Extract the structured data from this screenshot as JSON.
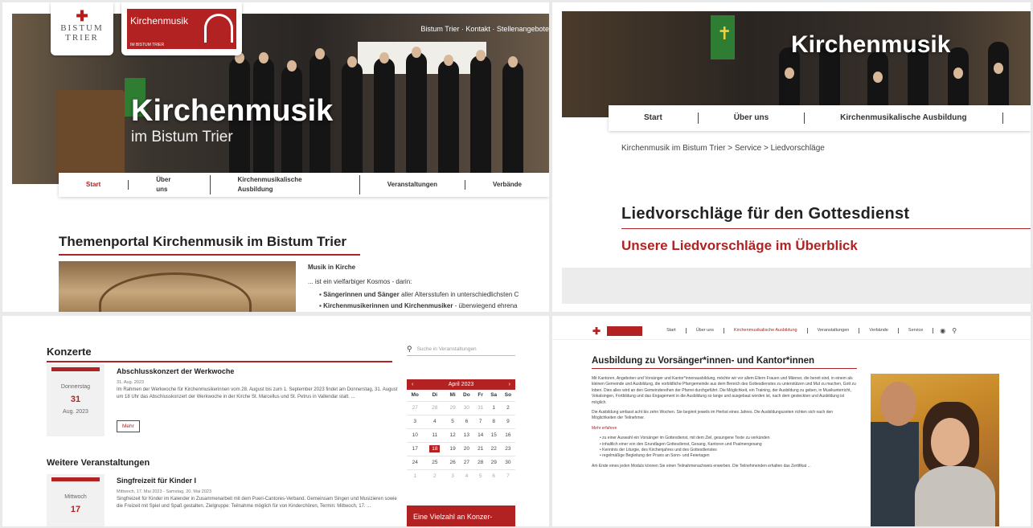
{
  "panel1": {
    "logo_bistum": "BISTUM TRIER",
    "logo_bistum_l1": "BISTUM",
    "logo_bistum_l2": "TRIER",
    "logo_km": "Kirchenmusik",
    "logo_km_sub": "IM BISTUM TRIER",
    "toplinks": "Bistum Trier · Kontakt · Stellenangebote",
    "hero_title": "Kirchenmusik",
    "hero_subtitle": "im Bistum Trier",
    "nav": [
      "Start",
      "Über uns",
      "Kirchenmusikalische Ausbildung",
      "Veranstaltungen",
      "Verbände"
    ],
    "section_title": "Themenportal Kirchenmusik im Bistum Trier",
    "text_heading": "Musik in Kirche",
    "text_intro": "... ist ein vielfarbiger Kosmos - darin:",
    "bullets": [
      {
        "bold": "Sängerinnen und Sänger",
        "rest": " aller Altersstufen in unterschiedlichsten C"
      },
      {
        "bold": "Kirchenmusikerinnen und Kirchenmusiker",
        "rest": " - überwiegend ehrena"
      }
    ]
  },
  "panel2": {
    "hero_title": "Kirchenmusik",
    "nav": [
      "Start",
      "Über uns",
      "Kirchenmusikalische Ausbildung"
    ],
    "breadcrumb": "Kirchenmusik im Bistum Trier  >  Service  >  Liedvorschläge",
    "title": "Liedvorschläge für den Gottesdienst",
    "subtitle": "Unsere Liedvorschläge im Überblick"
  },
  "panel3": {
    "heading": "Konzerte",
    "search_placeholder": "Suche in Veranstaltungen",
    "event1": {
      "weekday": "Donnerstag",
      "day": "31",
      "monthyear": "Aug. 2023",
      "title": "Abschlusskonzert der Werkwoche",
      "meta": "31. Aug. 2023",
      "text": "Im Rahmen der Werkwoche für Kirchenmusikerinnen vom 28. August bis zum 1. September 2023 findet am Donnerstag, 31. August um 18 Uhr das Abschlusskonzert der Werkwoche in der Kirche St. Marcellus und St. Petrus in Vallendar statt. ...",
      "more": "Mehr"
    },
    "heading2": "Weitere Veranstaltungen",
    "event2": {
      "weekday": "Mittwoch",
      "day": "17",
      "title": "Singfreizeit für Kinder I",
      "meta": "Mittwoch, 17. Mai 2023 - Samstag, 20. Mai 2023",
      "text": "Singfreizeit für Kinder im Kalender in Zusammenarbeit mit dem Pueri-Cantores-Verband. Gemeinsam Singen und Musizieren sowie die Freizeit mit Spiel und Spaß gestalten. Zielgruppe: Teilnahme möglich für von Kinderchören, Termin: Mittwoch, 17. ..."
    },
    "calendar": {
      "month": "April 2023",
      "prev": "‹",
      "next": "›",
      "weekdays": [
        "Mo",
        "Di",
        "Mi",
        "Do",
        "Fr",
        "Sa",
        "So"
      ],
      "weeks": [
        [
          "27",
          "28",
          "29",
          "30",
          "31",
          "1",
          "2"
        ],
        [
          "3",
          "4",
          "5",
          "6",
          "7",
          "8",
          "9"
        ],
        [
          "10",
          "11",
          "12",
          "13",
          "14",
          "15",
          "16"
        ],
        [
          "17",
          "18",
          "19",
          "20",
          "21",
          "22",
          "23"
        ],
        [
          "24",
          "25",
          "26",
          "27",
          "28",
          "29",
          "30"
        ],
        [
          "1",
          "2",
          "3",
          "4",
          "5",
          "6",
          "7"
        ]
      ],
      "selected": "18"
    },
    "promo": "Eine Vielzahl an Konzer-"
  },
  "panel4": {
    "nav": [
      "Start",
      "Über uns",
      "Kirchenmusikalische Ausbildung",
      "Veranstaltungen",
      "Verbände",
      "Service"
    ],
    "heading": "Ausbildung zu Vorsänger*innen- und Kantor*innen",
    "para1": "Mit Kantoren, Angeboten und Vorsänger und Kantor*innenausbildung, möchte wir vor allem Eltern Frauen und Männer, die bereit sind, in einem als kleinen Gemeinde und Ausbildung, die vorbildliche Pfarrgemeinde aus dem Bereich des Gottesdienstes zu unterstützen und Mut zu machen, Gott zu loben. Dies alles wird an den Gemeindereihen der Pfarrei durchgeführt. Die Möglichkeit, ein Training, der Ausbildung zu geben, in Musikunterricht, Vokalsingen, Fortbildung und das Engagement in die Ausbildung so lange und ausgebaut worden ist, nach dem gesteckten und Ausbildung ist möglich.",
    "para2": "Die Ausbildung umfasst acht bis zehn Wochen. Sie beginnt jeweils im Herbst eines Jahres. Die Ausbildungszeiten richten sich nach den Möglichkeiten der Teilnehmer.",
    "link_text": "Mehr erfahren",
    "bullets": [
      "zu einer Auswahl ein Vorsänger im Gottesdienst, mit dem Ziel, gesungene Texte zu verkünden",
      "inhaltlich einer von den Grundlagen Gottesdienst, Gesang, Kantoren und Psalmengesang",
      "Kenntnis der Liturgie, des Kirchenjahres und des Gottesdienstes",
      "regelmäßige Begleitung der Praxis an Sonn- und Feiertagen"
    ],
    "para3": "Am Ende eines jeden Moduls können Sie einen Teilnahmenachweis erwerben. Die Teilnehmenden erhalten das Zertifikat ..."
  }
}
